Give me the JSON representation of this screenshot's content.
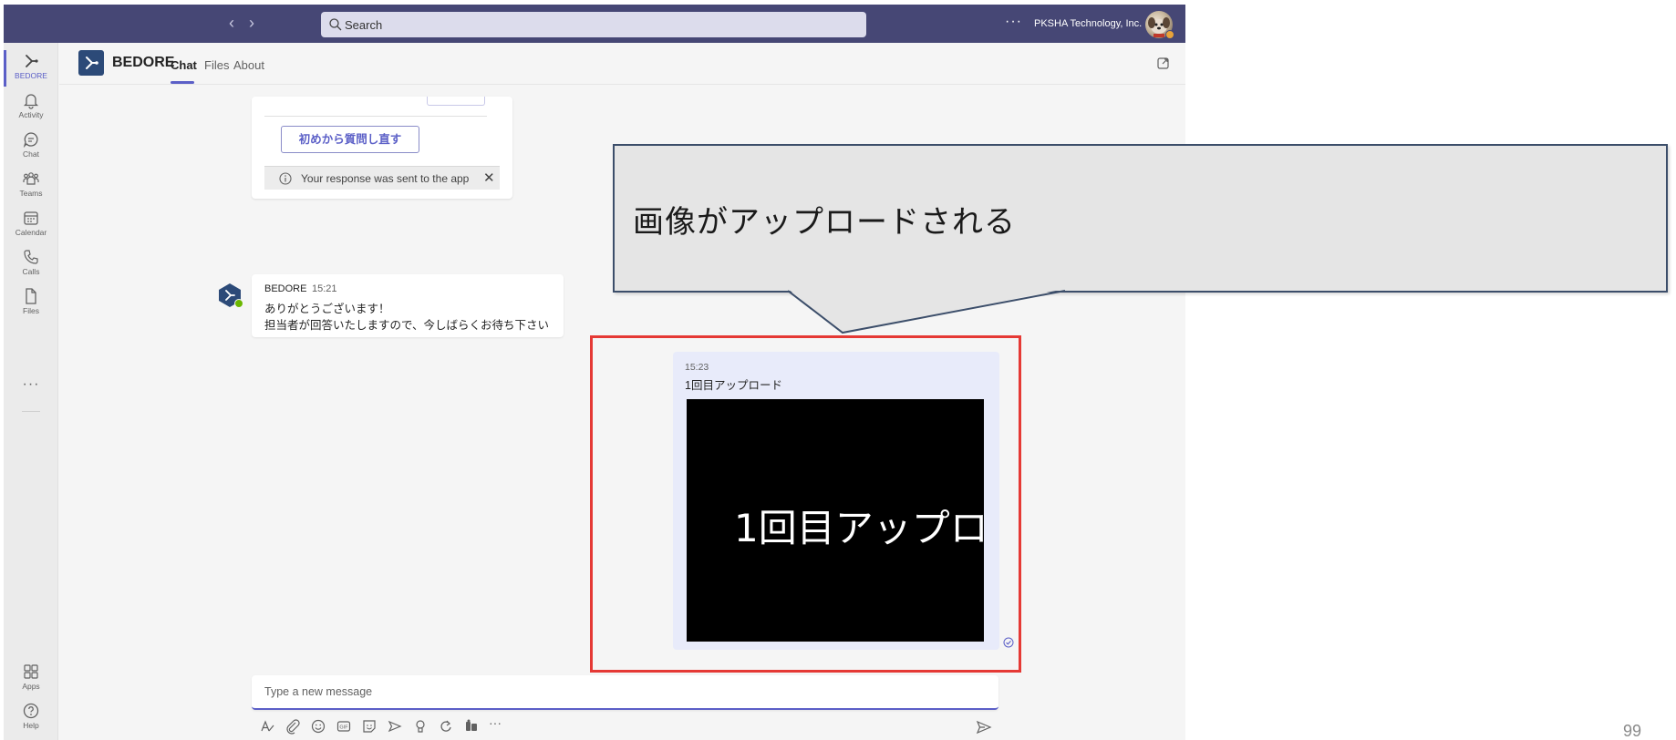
{
  "titlebar": {
    "search_placeholder": "Search",
    "org_name": "PKSHA Technology, Inc.",
    "more_label": "···"
  },
  "rail": {
    "items": [
      {
        "label": "BEDORE",
        "icon": "bedore-icon"
      },
      {
        "label": "Activity",
        "icon": "bell-icon"
      },
      {
        "label": "Chat",
        "icon": "chat-icon"
      },
      {
        "label": "Teams",
        "icon": "teams-icon"
      },
      {
        "label": "Calendar",
        "icon": "calendar-icon"
      },
      {
        "label": "Calls",
        "icon": "phone-icon"
      },
      {
        "label": "Files",
        "icon": "file-icon"
      }
    ],
    "more_label": "···",
    "bottom_items": [
      {
        "label": "Apps",
        "icon": "apps-icon"
      },
      {
        "label": "Help",
        "icon": "help-icon"
      }
    ]
  },
  "header": {
    "bot_name": "BEDORE",
    "tabs": [
      {
        "label": "Chat",
        "active": true
      },
      {
        "label": "Files",
        "active": false
      },
      {
        "label": "About",
        "active": false
      }
    ]
  },
  "messages": {
    "card": {
      "restart_button": "初めから質問し直す",
      "status_text": "Your response was sent to the app"
    },
    "bot_message": {
      "sender": "BEDORE",
      "time": "15:21",
      "line1": "ありがとうございます！",
      "line2": "担当者が回答いたしますので、今しばらくお待ち下さい"
    },
    "user_message": {
      "time": "15:23",
      "text": "1回目アップロード",
      "image_text": "1回目アップロ"
    }
  },
  "compose": {
    "placeholder": "Type a new message",
    "more_label": "···"
  },
  "annotation": {
    "callout_text": "画像がアップロードされる",
    "page_number": "99"
  },
  "colors": {
    "titlebar": "#464775",
    "accent": "#5b5fc7",
    "highlight": "#e53935",
    "own_message_bg": "#e8ebfa"
  }
}
